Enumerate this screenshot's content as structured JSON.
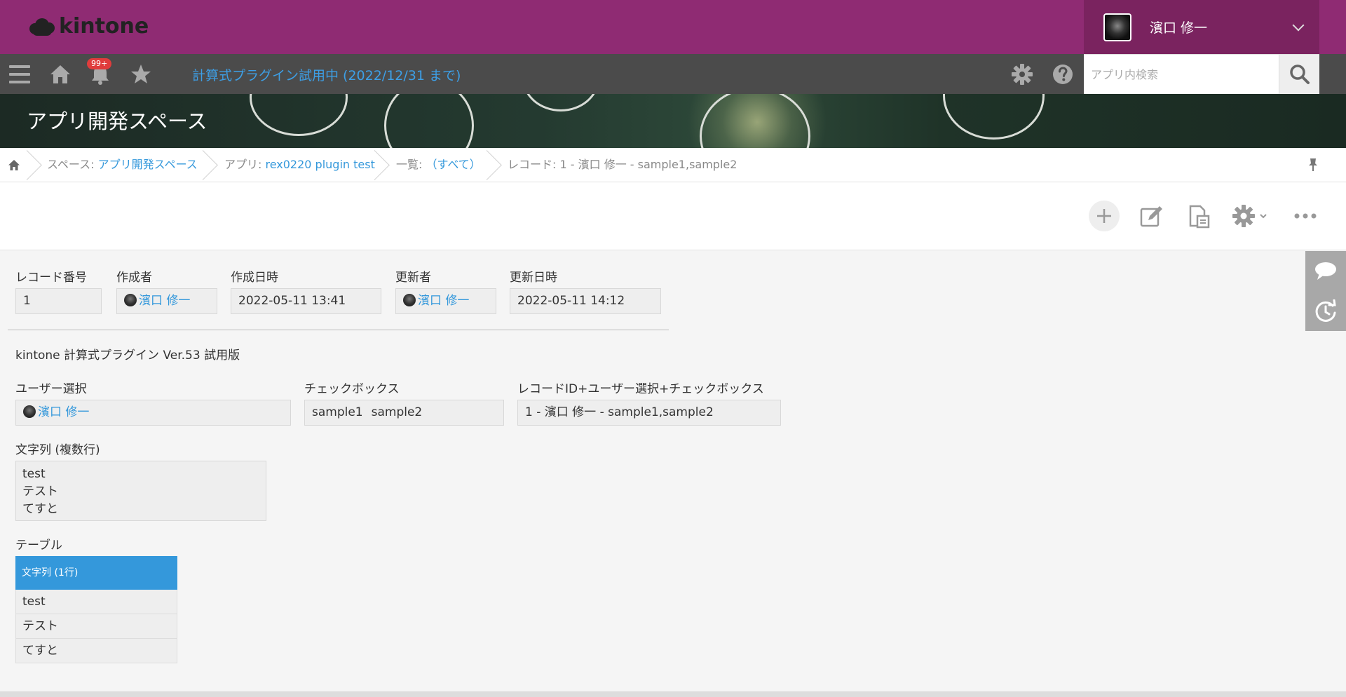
{
  "brand": {
    "logo_text": "kintone"
  },
  "user": {
    "name": "濱口 修一"
  },
  "toolbar": {
    "notification_badge": "99+",
    "trial_notice": "計算式プラグイン試用中 (2022/12/31 まで)",
    "search": {
      "placeholder": "アプリ内検索",
      "value": ""
    }
  },
  "banner": {
    "space_title": "アプリ開発スペース"
  },
  "breadcrumb": {
    "space_prefix": "スペース: ",
    "space_name": "アプリ開発スペース",
    "app_prefix": "アプリ: ",
    "app_name": "rex0220 plugin test",
    "view_prefix": "一覧: ",
    "view_name": "（すべて）",
    "record": "レコード: 1 - 濱口 修一 - sample1,sample2"
  },
  "record": {
    "meta": [
      {
        "label": "レコード番号",
        "value": "1"
      },
      {
        "label": "作成者",
        "value": "濱口 修一"
      },
      {
        "label": "作成日時",
        "value": "2022-05-11 13:41"
      },
      {
        "label": "更新者",
        "value": "濱口 修一"
      },
      {
        "label": "更新日時",
        "value": "2022-05-11 14:12"
      }
    ],
    "plugin_title": "kintone 計算式プラグイン Ver.53 試用版",
    "user_select": {
      "label": "ユーザー選択",
      "value": "濱口 修一"
    },
    "checkbox": {
      "label": "チェックボックス",
      "values": [
        "sample1",
        "sample2"
      ]
    },
    "combined": {
      "label": "レコードID+ユーザー選択+チェックボックス",
      "value": "1 - 濱口 修一 - sample1,sample2"
    },
    "multiline": {
      "label": "文字列 (複数行)",
      "lines": [
        "test",
        "テスト",
        "てすと"
      ]
    },
    "table": {
      "label": "テーブル",
      "column": "文字列 (1行)",
      "rows": [
        "test",
        "テスト",
        "てすと"
      ]
    }
  },
  "colors": {
    "header_bg": "#8f2b73",
    "toolbar_bg": "#4b4b4b",
    "link": "#3498db",
    "table_header": "#3498db",
    "badge": "#e03c3c"
  }
}
